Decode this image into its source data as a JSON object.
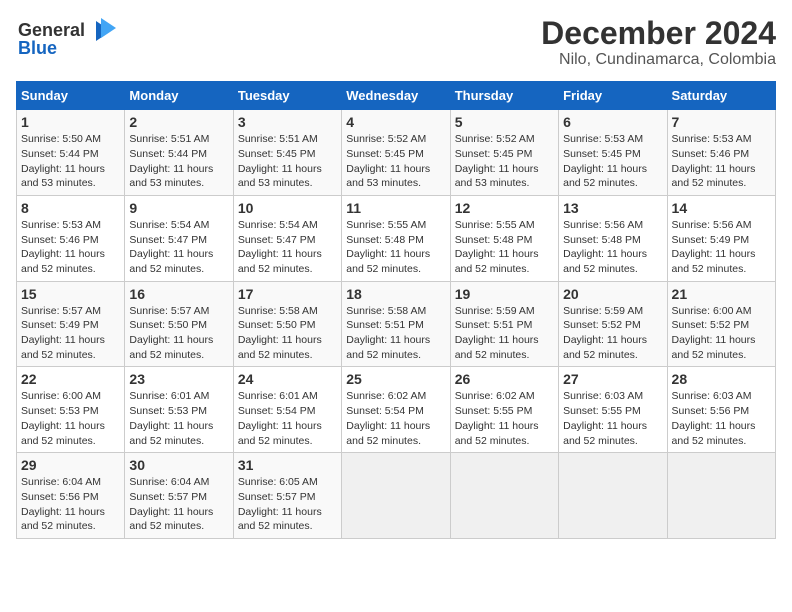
{
  "logo": {
    "line1": "General",
    "line2": "Blue"
  },
  "title": "December 2024",
  "subtitle": "Nilo, Cundinamarca, Colombia",
  "days_of_week": [
    "Sunday",
    "Monday",
    "Tuesday",
    "Wednesday",
    "Thursday",
    "Friday",
    "Saturday"
  ],
  "weeks": [
    [
      {
        "day": "1",
        "info": "Sunrise: 5:50 AM\nSunset: 5:44 PM\nDaylight: 11 hours\nand 53 minutes."
      },
      {
        "day": "2",
        "info": "Sunrise: 5:51 AM\nSunset: 5:44 PM\nDaylight: 11 hours\nand 53 minutes."
      },
      {
        "day": "3",
        "info": "Sunrise: 5:51 AM\nSunset: 5:45 PM\nDaylight: 11 hours\nand 53 minutes."
      },
      {
        "day": "4",
        "info": "Sunrise: 5:52 AM\nSunset: 5:45 PM\nDaylight: 11 hours\nand 53 minutes."
      },
      {
        "day": "5",
        "info": "Sunrise: 5:52 AM\nSunset: 5:45 PM\nDaylight: 11 hours\nand 53 minutes."
      },
      {
        "day": "6",
        "info": "Sunrise: 5:53 AM\nSunset: 5:45 PM\nDaylight: 11 hours\nand 52 minutes."
      },
      {
        "day": "7",
        "info": "Sunrise: 5:53 AM\nSunset: 5:46 PM\nDaylight: 11 hours\nand 52 minutes."
      }
    ],
    [
      {
        "day": "8",
        "info": "Sunrise: 5:53 AM\nSunset: 5:46 PM\nDaylight: 11 hours\nand 52 minutes."
      },
      {
        "day": "9",
        "info": "Sunrise: 5:54 AM\nSunset: 5:47 PM\nDaylight: 11 hours\nand 52 minutes."
      },
      {
        "day": "10",
        "info": "Sunrise: 5:54 AM\nSunset: 5:47 PM\nDaylight: 11 hours\nand 52 minutes."
      },
      {
        "day": "11",
        "info": "Sunrise: 5:55 AM\nSunset: 5:48 PM\nDaylight: 11 hours\nand 52 minutes."
      },
      {
        "day": "12",
        "info": "Sunrise: 5:55 AM\nSunset: 5:48 PM\nDaylight: 11 hours\nand 52 minutes."
      },
      {
        "day": "13",
        "info": "Sunrise: 5:56 AM\nSunset: 5:48 PM\nDaylight: 11 hours\nand 52 minutes."
      },
      {
        "day": "14",
        "info": "Sunrise: 5:56 AM\nSunset: 5:49 PM\nDaylight: 11 hours\nand 52 minutes."
      }
    ],
    [
      {
        "day": "15",
        "info": "Sunrise: 5:57 AM\nSunset: 5:49 PM\nDaylight: 11 hours\nand 52 minutes."
      },
      {
        "day": "16",
        "info": "Sunrise: 5:57 AM\nSunset: 5:50 PM\nDaylight: 11 hours\nand 52 minutes."
      },
      {
        "day": "17",
        "info": "Sunrise: 5:58 AM\nSunset: 5:50 PM\nDaylight: 11 hours\nand 52 minutes."
      },
      {
        "day": "18",
        "info": "Sunrise: 5:58 AM\nSunset: 5:51 PM\nDaylight: 11 hours\nand 52 minutes."
      },
      {
        "day": "19",
        "info": "Sunrise: 5:59 AM\nSunset: 5:51 PM\nDaylight: 11 hours\nand 52 minutes."
      },
      {
        "day": "20",
        "info": "Sunrise: 5:59 AM\nSunset: 5:52 PM\nDaylight: 11 hours\nand 52 minutes."
      },
      {
        "day": "21",
        "info": "Sunrise: 6:00 AM\nSunset: 5:52 PM\nDaylight: 11 hours\nand 52 minutes."
      }
    ],
    [
      {
        "day": "22",
        "info": "Sunrise: 6:00 AM\nSunset: 5:53 PM\nDaylight: 11 hours\nand 52 minutes."
      },
      {
        "day": "23",
        "info": "Sunrise: 6:01 AM\nSunset: 5:53 PM\nDaylight: 11 hours\nand 52 minutes."
      },
      {
        "day": "24",
        "info": "Sunrise: 6:01 AM\nSunset: 5:54 PM\nDaylight: 11 hours\nand 52 minutes."
      },
      {
        "day": "25",
        "info": "Sunrise: 6:02 AM\nSunset: 5:54 PM\nDaylight: 11 hours\nand 52 minutes."
      },
      {
        "day": "26",
        "info": "Sunrise: 6:02 AM\nSunset: 5:55 PM\nDaylight: 11 hours\nand 52 minutes."
      },
      {
        "day": "27",
        "info": "Sunrise: 6:03 AM\nSunset: 5:55 PM\nDaylight: 11 hours\nand 52 minutes."
      },
      {
        "day": "28",
        "info": "Sunrise: 6:03 AM\nSunset: 5:56 PM\nDaylight: 11 hours\nand 52 minutes."
      }
    ],
    [
      {
        "day": "29",
        "info": "Sunrise: 6:04 AM\nSunset: 5:56 PM\nDaylight: 11 hours\nand 52 minutes."
      },
      {
        "day": "30",
        "info": "Sunrise: 6:04 AM\nSunset: 5:57 PM\nDaylight: 11 hours\nand 52 minutes."
      },
      {
        "day": "31",
        "info": "Sunrise: 6:05 AM\nSunset: 5:57 PM\nDaylight: 11 hours\nand 52 minutes."
      },
      {
        "day": "",
        "info": ""
      },
      {
        "day": "",
        "info": ""
      },
      {
        "day": "",
        "info": ""
      },
      {
        "day": "",
        "info": ""
      }
    ]
  ]
}
